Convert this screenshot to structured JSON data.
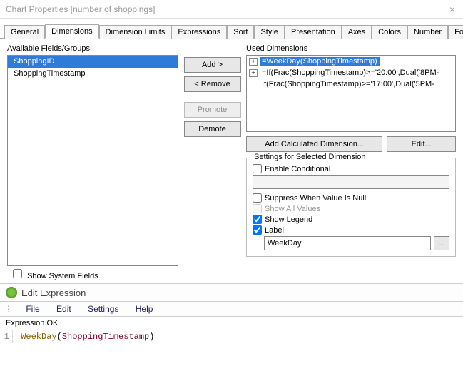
{
  "window": {
    "title": "Chart Properties [number of shoppings]"
  },
  "tabs": {
    "items": [
      "General",
      "Dimensions",
      "Dimension Limits",
      "Expressions",
      "Sort",
      "Style",
      "Presentation",
      "Axes",
      "Colors",
      "Number",
      "Font"
    ],
    "active_index": 1
  },
  "left": {
    "label": "Available Fields/Groups",
    "items": [
      "ShoppingID",
      "ShoppingTimestamp"
    ],
    "selected_index": 0,
    "show_system_fields_label": "Show System Fields"
  },
  "mid_buttons": {
    "add": "Add >",
    "remove": "< Remove",
    "promote": "Promote",
    "demote": "Demote"
  },
  "right": {
    "label": "Used Dimensions",
    "items": [
      "=WeekDay(ShoppingTimestamp)",
      "=If(Frac(ShoppingTimestamp)>='20:00',Dual('8PM-",
      "   If(Frac(ShoppingTimestamp)>='17:00',Dual('5PM-"
    ],
    "selected_index": 0,
    "add_calc": "Add Calculated Dimension...",
    "edit": "Edit..."
  },
  "settings": {
    "legend": "Settings for Selected Dimension",
    "enable_conditional": "Enable Conditional",
    "suppress_null": "Suppress When Value Is Null",
    "show_all": "Show All Values",
    "show_legend": "Show Legend",
    "label": "Label",
    "label_value": "WeekDay"
  },
  "editor": {
    "title": "Edit Expression",
    "menu": [
      "File",
      "Edit",
      "Settings",
      "Help"
    ],
    "status": "Expression OK",
    "line_no": "1",
    "expr_op": "=",
    "expr_func": "WeekDay",
    "expr_paren_open": "(",
    "expr_arg": "ShoppingTimestamp",
    "expr_paren_close": ")"
  }
}
